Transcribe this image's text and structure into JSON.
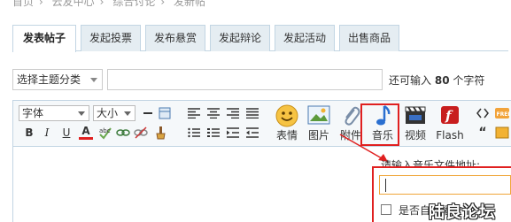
{
  "breadcrumb": [
    "首页",
    "云友中心",
    "综合讨论",
    "发新帖"
  ],
  "tabs": [
    {
      "label": "发表帖子",
      "active": true
    },
    {
      "label": "发起投票",
      "active": false
    },
    {
      "label": "发布悬赏",
      "active": false
    },
    {
      "label": "发起辩论",
      "active": false
    },
    {
      "label": "发起活动",
      "active": false
    },
    {
      "label": "出售商品",
      "active": false
    }
  ],
  "topic_select": {
    "value": "选择主题分类"
  },
  "subject": {
    "value": ""
  },
  "counter": {
    "prefix": "还可输入",
    "count": "80",
    "suffix": "个字符"
  },
  "toolbar": {
    "font_label": "字体",
    "size_label": "大小",
    "buttons": {
      "bold": "B",
      "italic": "I",
      "underline": "U",
      "font_color": "A"
    },
    "emoticon": "表情",
    "image": "图片",
    "attachment": "附件",
    "music": "音乐",
    "video": "视频",
    "flash": "Flash"
  },
  "music_popup": {
    "label": "请输入音乐文件地址:",
    "url_value": "",
    "autoplay_label": "是否自动播放"
  },
  "watermark": "陆良论坛",
  "colors": {
    "accent_border": "#c2d5e3",
    "highlight_red": "#e02020"
  }
}
